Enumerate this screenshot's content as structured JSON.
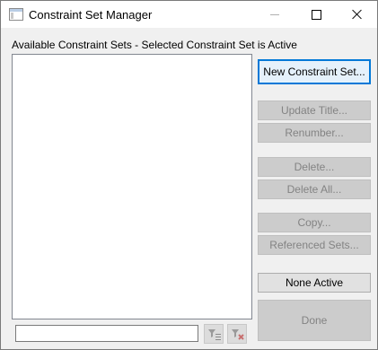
{
  "window": {
    "title": "Constraint Set Manager",
    "controls": [
      "minimize",
      "maximize",
      "close"
    ]
  },
  "list": {
    "caption": "Available Constraint Sets - Selected Constraint Set is Active",
    "items": []
  },
  "buttons": {
    "new_constraint_set": "New Constraint Set...",
    "update_title": "Update Title...",
    "renumber": "Renumber...",
    "delete": "Delete...",
    "delete_all": "Delete All...",
    "copy": "Copy...",
    "referenced_sets": "Referenced Sets...",
    "none_active": "None Active",
    "done": "Done"
  },
  "filter": {
    "value": "",
    "apply_icon": "filter-list-icon",
    "clear_icon": "clear-filter-icon"
  },
  "colors": {
    "focus_border": "#0078d7",
    "disabled_text": "#838383"
  }
}
